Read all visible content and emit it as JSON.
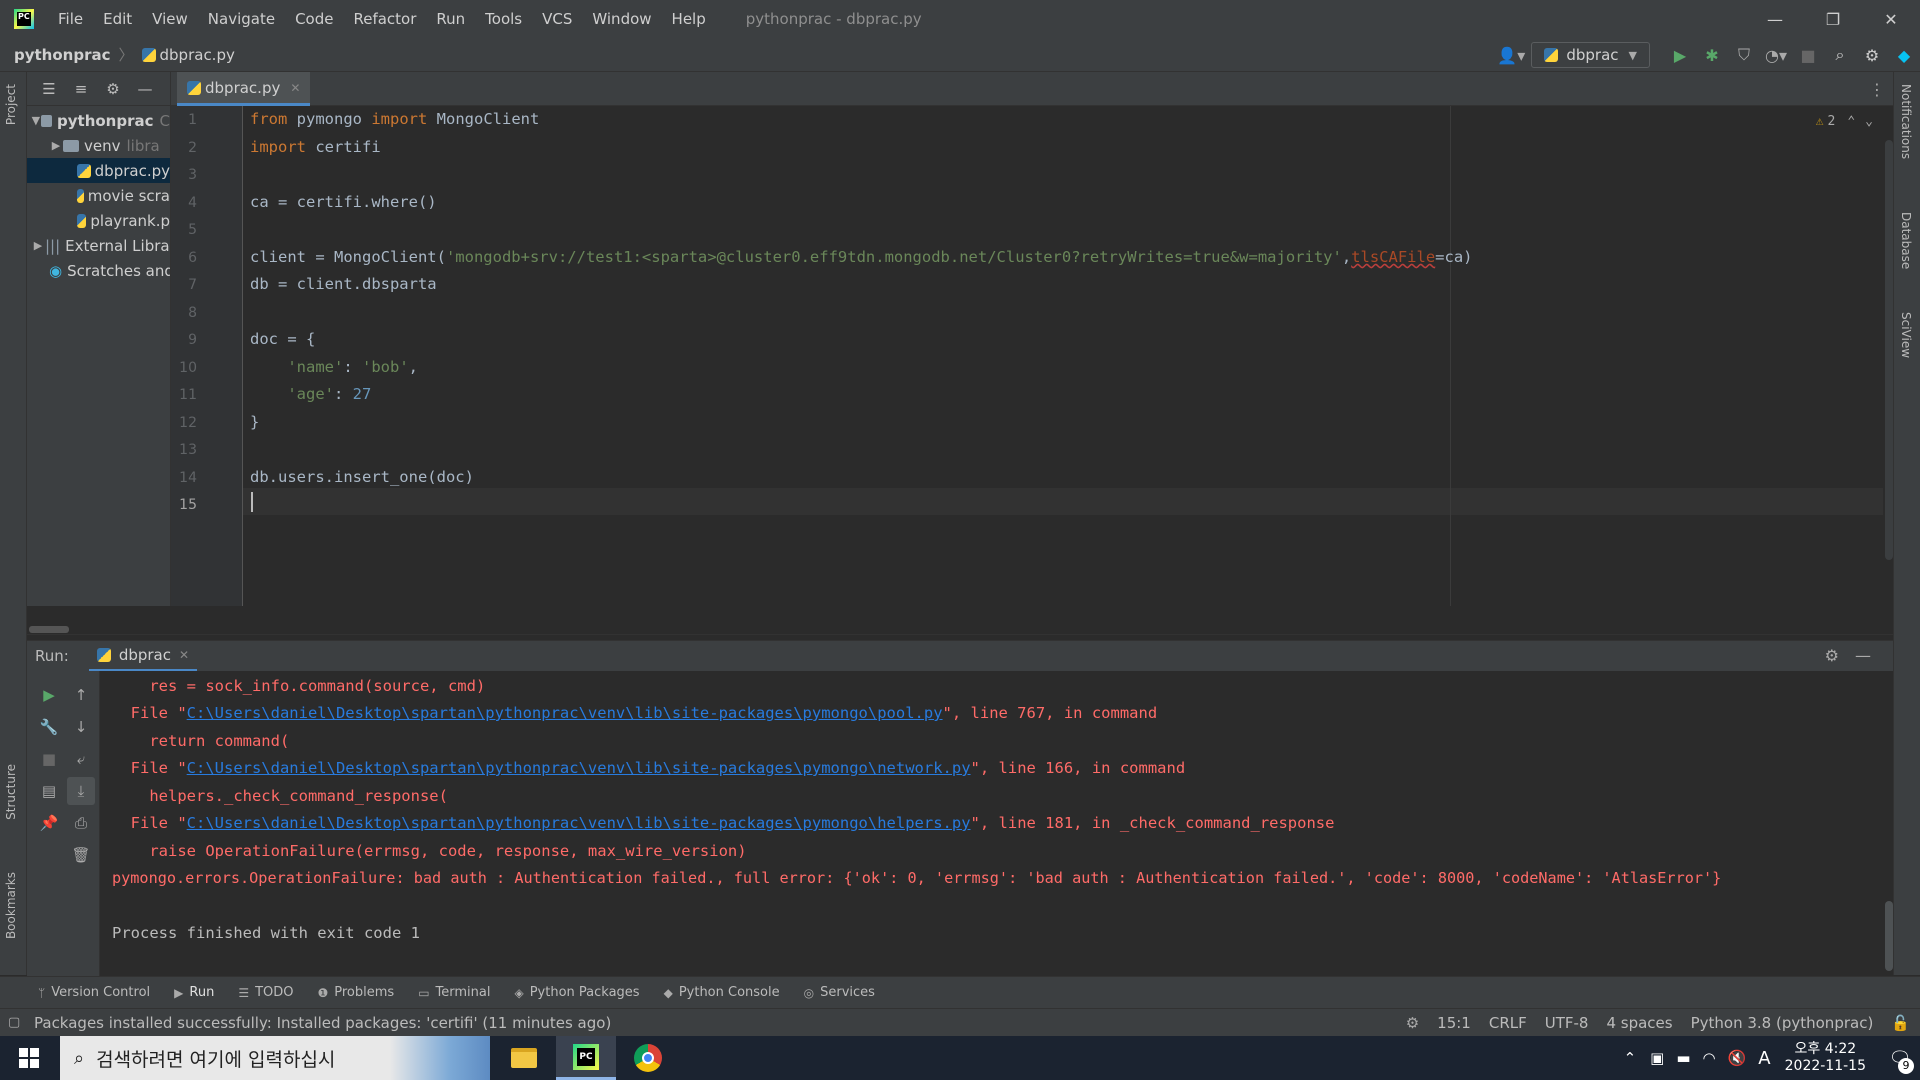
{
  "titlebar": {
    "menu": [
      "File",
      "Edit",
      "View",
      "Navigate",
      "Code",
      "Refactor",
      "Run",
      "Tools",
      "VCS",
      "Window",
      "Help"
    ],
    "window_title": "pythonprac - dbprac.py"
  },
  "navbar": {
    "project": "pythonprac",
    "file": "dbprac.py",
    "run_config": "dbprac"
  },
  "left_strip": {
    "project": "Project",
    "structure": "Structure",
    "bookmarks": "Bookmarks"
  },
  "right_strip": {
    "notifications": "Notifications",
    "database": "Database",
    "sciview": "SciView"
  },
  "project_tree": {
    "root": "pythonprac",
    "root_suffix": "C",
    "venv": "venv",
    "venv_suffix": "libra",
    "files": [
      "dbprac.py",
      "movie scra",
      "playrank.p"
    ],
    "external": "External Libra",
    "scratches": "Scratches and"
  },
  "editor": {
    "tab": "dbprac.py",
    "warnings": "2",
    "line_numbers": [
      "1",
      "2",
      "3",
      "4",
      "5",
      "6",
      "7",
      "8",
      "9",
      "10",
      "11",
      "12",
      "13",
      "14",
      "15"
    ],
    "code": {
      "l1_kw": "from",
      "l1_a": " pymongo ",
      "l1_kw2": "import",
      "l1_b": " MongoClient",
      "l2_kw": "import",
      "l2_a": " certifi",
      "l4": "ca = certifi.where()",
      "l6_a": "client = MongoClient(",
      "l6_str": "'mongodb+srv://test1:<sparta>@cluster0.eff9tdn.mongodb.net/Cluster0?retryWrites=true&w=majority'",
      "l6_comma": ",",
      "l6_param": "tlsCAFile",
      "l6_b": "=ca)",
      "l7": "db = client.dbsparta",
      "l9": "doc = {",
      "l10_indent": "    ",
      "l10_key": "'name'",
      "l10_colon": ": ",
      "l10_val": "'bob'",
      "l10_comma": ",",
      "l11_indent": "    ",
      "l11_key": "'age'",
      "l11_colon": ": ",
      "l11_val": "27",
      "l12": "}",
      "l14": "db.users.insert_one(doc)"
    }
  },
  "run_panel": {
    "label": "Run:",
    "tab": "dbprac",
    "output": {
      "o1": "    res = sock_info.command(source, cmd)",
      "o2_a": "  File \"",
      "o2_link": "C:\\Users\\daniel\\Desktop\\spartan\\pythonprac\\venv\\lib\\site-packages\\pymongo\\pool.py",
      "o2_b": "\", line 767, in command",
      "o3": "    return command(",
      "o4_a": "  File \"",
      "o4_link": "C:\\Users\\daniel\\Desktop\\spartan\\pythonprac\\venv\\lib\\site-packages\\pymongo\\network.py",
      "o4_b": "\", line 166, in command",
      "o5": "    helpers._check_command_response(",
      "o6_a": "  File \"",
      "o6_link": "C:\\Users\\daniel\\Desktop\\spartan\\pythonprac\\venv\\lib\\site-packages\\pymongo\\helpers.py",
      "o6_b": "\", line 181, in _check_command_response",
      "o7": "    raise OperationFailure(errmsg, code, response, max_wire_version)",
      "o8": "pymongo.errors.OperationFailure: bad auth : Authentication failed., full error: {'ok': 0, 'errmsg': 'bad auth : Authentication failed.', 'code': 8000, 'codeName': 'AtlasError'}",
      "o10": "Process finished with exit code 1"
    }
  },
  "toolwindows": [
    "Version Control",
    "Run",
    "TODO",
    "Problems",
    "Terminal",
    "Python Packages",
    "Python Console",
    "Services"
  ],
  "statusbar": {
    "message": "Packages installed successfully: Installed packages: 'certifi' (11 minutes ago)",
    "position": "15:1",
    "line_sep": "CRLF",
    "encoding": "UTF-8",
    "indent": "4 spaces",
    "interpreter": "Python 3.8 (pythonprac)"
  },
  "taskbar": {
    "search_placeholder": "검색하려면 여기에 입력하십시",
    "ime": "A",
    "time": "오후 4:22",
    "date": "2022-11-15",
    "notifications": "9"
  }
}
